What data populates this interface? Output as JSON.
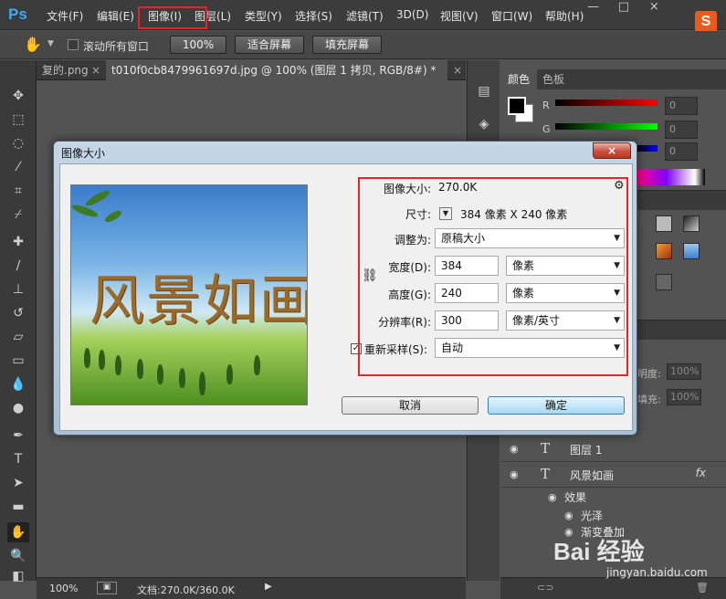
{
  "menubar": {
    "logo": "Ps",
    "items": [
      "文件(F)",
      "编辑(E)",
      "图像(I)",
      "图层(L)",
      "类型(Y)",
      "选择(S)",
      "滤镜(T)",
      "3D(D)",
      "视图(V)",
      "窗口(W)",
      "帮助(H)"
    ],
    "window_buttons": [
      "—",
      "□",
      "×"
    ],
    "highlight_item": "图像(I)"
  },
  "options": {
    "scroll_all_label": "滚动所有窗口",
    "zoom_100": "100%",
    "fit_screen": "适合屏幕",
    "fill_screen": "填充屏幕"
  },
  "tabs": [
    {
      "label": "复的.png",
      "close": "×"
    },
    {
      "label": "t010f0cb8479961697d.jpg @ 100% (图层 1 拷贝, RGB/8#) *",
      "close": "×"
    }
  ],
  "panels": {
    "color_tab": "颜色",
    "swatches_tab": "色板",
    "r_label": "R",
    "g_label": "G",
    "r_value": "0",
    "g_value": "0",
    "b_value": "0"
  },
  "layers_panel": {
    "opacity_label": "明度:",
    "opacity_value": "100%",
    "fill_label": "填充:",
    "fill_value": "100%",
    "layers": [
      {
        "name": "图层 1",
        "type": "T"
      },
      {
        "name": "风景如画",
        "type": "T",
        "fx": "fx"
      }
    ],
    "effects_label": "效果",
    "effects": [
      "光泽",
      "渐变叠加"
    ]
  },
  "status": {
    "zoom": "100%",
    "doc_info": "文档:270.0K/360.0K"
  },
  "dialog": {
    "title": "图像大小",
    "close": "×",
    "preview_text": "风景如画",
    "image_size_label": "图像大小:",
    "image_size_value": "270.0K",
    "dimensions_label": "尺寸:",
    "dimensions_value": "384 像素  X  240 像素",
    "fit_label": "调整为:",
    "fit_value": "原稿大小",
    "width_label": "宽度(D):",
    "width_value": "384",
    "width_unit": "像素",
    "height_label": "高度(G):",
    "height_value": "240",
    "height_unit": "像素",
    "resolution_label": "分辨率(R):",
    "resolution_value": "300",
    "resolution_unit": "像素/英寸",
    "resample_label": "重新采样(S):",
    "resample_value": "自动",
    "cancel": "取消",
    "ok": "确定"
  },
  "watermark": {
    "brand": "Bai 经验",
    "url": "jingyan.baidu.com"
  },
  "colors": {
    "highlight": "#e0252c",
    "ps_blue": "#3fa9f5"
  }
}
